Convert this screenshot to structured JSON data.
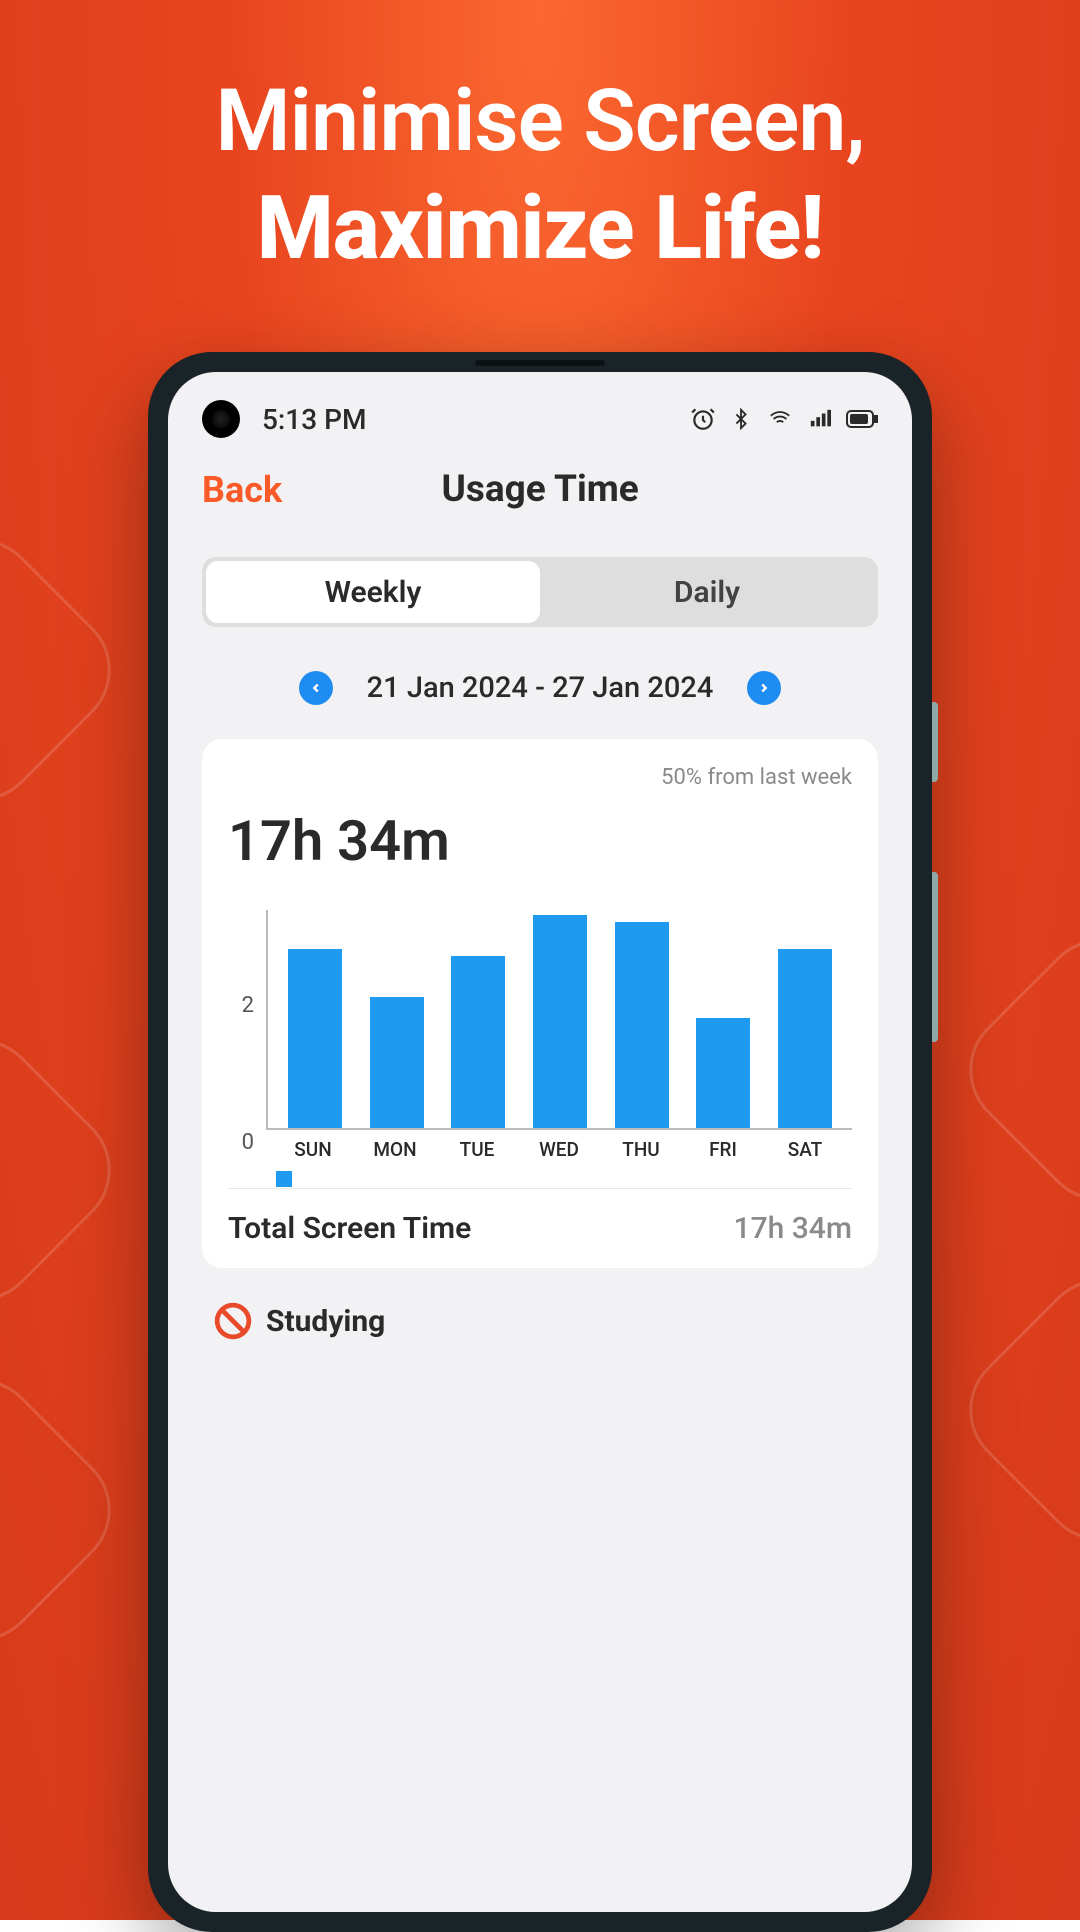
{
  "hero": {
    "line1": "Minimise Screen,",
    "line2": "Maximize Life!"
  },
  "statusbar": {
    "time": "5:13 PM"
  },
  "header": {
    "back": "Back",
    "title": "Usage Time"
  },
  "tabs": {
    "weekly": "Weekly",
    "daily": "Daily"
  },
  "dateRange": "21 Jan 2024 - 27 Jan 2024",
  "compare": "50% from last week",
  "totalTime": "17h 34m",
  "chart_data": {
    "type": "bar",
    "categories": [
      "SUN",
      "MON",
      "TUE",
      "WED",
      "THU",
      "FRI",
      "SAT"
    ],
    "values": [
      2.6,
      1.9,
      2.5,
      3.1,
      3.0,
      1.6,
      2.6
    ],
    "yticks": [
      0,
      2
    ],
    "ylim": [
      0,
      3.2
    ],
    "xlabel": "",
    "ylabel": "",
    "title": ""
  },
  "totalRow": {
    "label": "Total Screen Time",
    "value": "17h 34m"
  },
  "section": {
    "studying": "Studying"
  }
}
